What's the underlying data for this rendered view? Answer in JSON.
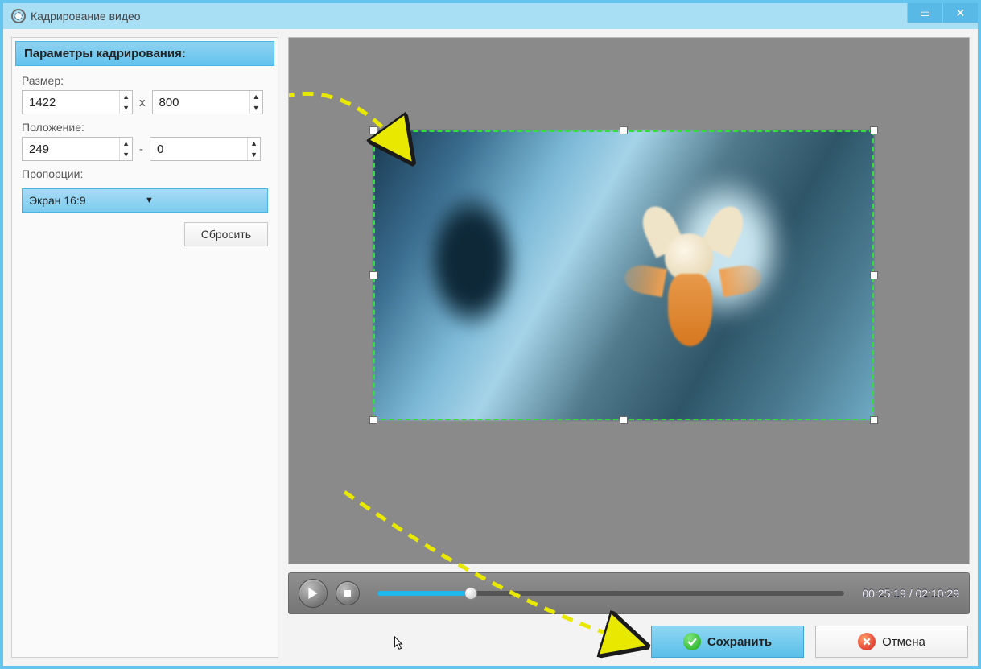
{
  "window": {
    "title": "Кадрирование видео"
  },
  "sidebar": {
    "header": "Параметры кадрирования:",
    "size_label": "Размер:",
    "size_w": "1422",
    "size_h": "800",
    "size_sep": "x",
    "pos_label": "Положение:",
    "pos_x": "249",
    "pos_y": "0",
    "pos_sep": "-",
    "ratio_label": "Пропорции:",
    "ratio_value": "Экран 16:9",
    "reset": "Сбросить"
  },
  "playbar": {
    "current": "00:25:19",
    "sep": " / ",
    "total": "02:10:29"
  },
  "footer": {
    "save": "Сохранить",
    "cancel": "Отмена"
  }
}
